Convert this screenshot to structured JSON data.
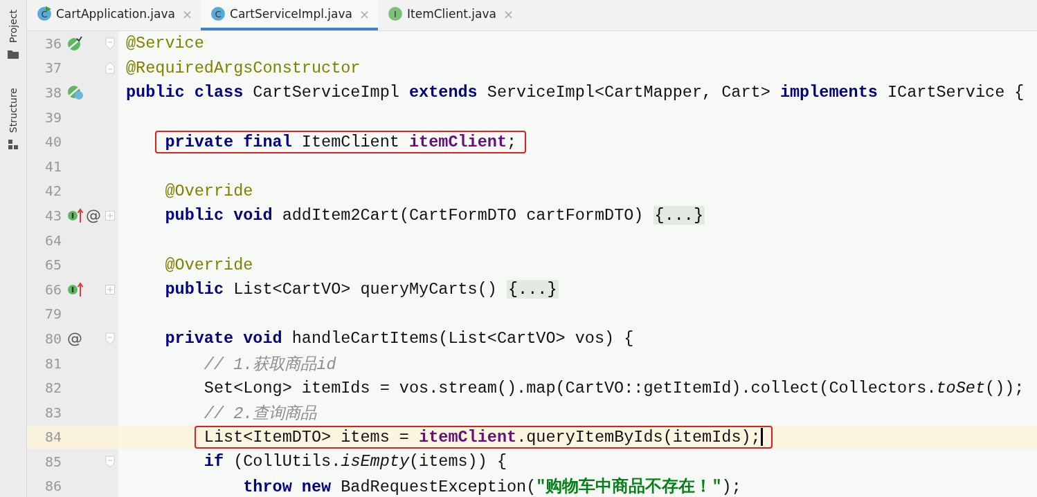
{
  "sidebar": {
    "items": [
      {
        "label": "Project"
      },
      {
        "label": "Structure"
      }
    ]
  },
  "tabs": [
    {
      "label": "CartApplication.java",
      "selected": false,
      "icon": {
        "kind": "app",
        "letter": "C"
      },
      "close": "×"
    },
    {
      "label": "CartServiceImpl.java",
      "selected": true,
      "icon": {
        "kind": "class",
        "letter": "C"
      },
      "close": "×"
    },
    {
      "label": "ItemClient.java",
      "selected": false,
      "icon": {
        "kind": "interface",
        "letter": "I"
      },
      "close": "×"
    }
  ],
  "editor": {
    "lines": [
      {
        "number": "36",
        "markers": [
          {
            "kind": "bean"
          }
        ],
        "fold": {
          "kind": "open"
        },
        "tokens": [
          {
            "text": "@Service",
            "kind": "annotation"
          }
        ]
      },
      {
        "number": "37",
        "fold": {
          "kind": "close"
        },
        "tokens": [
          {
            "text": "@RequiredArgsConstructor",
            "kind": "annotation"
          }
        ]
      },
      {
        "number": "38",
        "markers": [
          {
            "kind": "bean-class"
          }
        ],
        "tokens": [
          {
            "text": "public class",
            "kind": "keyword"
          },
          {
            "text": " CartServiceImpl ",
            "kind": "plain"
          },
          {
            "text": "extends",
            "kind": "keyword"
          },
          {
            "text": " ServiceImpl<CartMapper, Cart> ",
            "kind": "plain"
          },
          {
            "text": "implements",
            "kind": "keyword"
          },
          {
            "text": " ICartService {",
            "kind": "plain"
          }
        ]
      },
      {
        "number": "39"
      },
      {
        "number": "40",
        "boxed": true,
        "tokens": [
          {
            "text": "    private final",
            "kind": "keyword"
          },
          {
            "text": " ItemClient ",
            "kind": "plain"
          },
          {
            "text": "itemClient",
            "kind": "field"
          },
          {
            "text": ";",
            "kind": "plain"
          }
        ]
      },
      {
        "number": "41"
      },
      {
        "number": "42",
        "tokens": [
          {
            "text": "    @Override",
            "kind": "annotation"
          }
        ]
      },
      {
        "number": "43",
        "markers": [
          {
            "kind": "implements"
          },
          {
            "kind": "usage",
            "text": "@"
          }
        ],
        "fold": {
          "kind": "collapsed"
        },
        "tokens": [
          {
            "text": "    public void",
            "kind": "keyword"
          },
          {
            "text": " addItem2Cart(CartFormDTO cartFormDTO) ",
            "kind": "plain"
          },
          {
            "text": "{...}",
            "kind": "folded"
          }
        ]
      },
      {
        "number": "64"
      },
      {
        "number": "65",
        "tokens": [
          {
            "text": "    @Override",
            "kind": "annotation"
          }
        ]
      },
      {
        "number": "66",
        "markers": [
          {
            "kind": "implements"
          }
        ],
        "fold": {
          "kind": "collapsed"
        },
        "tokens": [
          {
            "text": "    public",
            "kind": "keyword"
          },
          {
            "text": " List<CartVO> queryMyCarts() ",
            "kind": "plain"
          },
          {
            "text": "{...}",
            "kind": "folded"
          }
        ]
      },
      {
        "number": "79"
      },
      {
        "number": "80",
        "markers": [
          {
            "kind": "usage",
            "text": "@"
          }
        ],
        "fold": {
          "kind": "open"
        },
        "tokens": [
          {
            "text": "    private void",
            "kind": "keyword"
          },
          {
            "text": " handleCartItems(List<CartVO> vos) {",
            "kind": "plain"
          }
        ]
      },
      {
        "number": "81",
        "tokens": [
          {
            "text": "        // 1.获取商品id",
            "kind": "comment"
          }
        ]
      },
      {
        "number": "82",
        "tokens": [
          {
            "text": "        Set<Long> itemIds = vos.stream().map(CartVO::getItemId).collect(Collectors.",
            "kind": "plain"
          },
          {
            "text": "toSet",
            "kind": "static"
          },
          {
            "text": "());",
            "kind": "plain"
          }
        ]
      },
      {
        "number": "83",
        "tokens": [
          {
            "text": "        // 2.查询商品",
            "kind": "comment"
          }
        ]
      },
      {
        "number": "84",
        "current": true,
        "boxed": true,
        "caret": true,
        "tokens": [
          {
            "text": "        List<ItemDTO> items = ",
            "kind": "plain"
          },
          {
            "text": "itemClient",
            "kind": "field"
          },
          {
            "text": ".queryItemByIds(itemIds);",
            "kind": "plain"
          }
        ]
      },
      {
        "number": "85",
        "fold": {
          "kind": "open"
        },
        "tokens": [
          {
            "text": "        if",
            "kind": "keyword"
          },
          {
            "text": " (CollUtils.",
            "kind": "plain"
          },
          {
            "text": "isEmpty",
            "kind": "static"
          },
          {
            "text": "(items)) {",
            "kind": "plain"
          }
        ]
      },
      {
        "number": "86",
        "tokens": [
          {
            "text": "            throw new",
            "kind": "keyword"
          },
          {
            "text": " BadRequestException(",
            "kind": "plain"
          },
          {
            "text": "\"购物车中商品不存在！\"",
            "kind": "string"
          },
          {
            "text": ");",
            "kind": "plain"
          }
        ]
      }
    ]
  }
}
